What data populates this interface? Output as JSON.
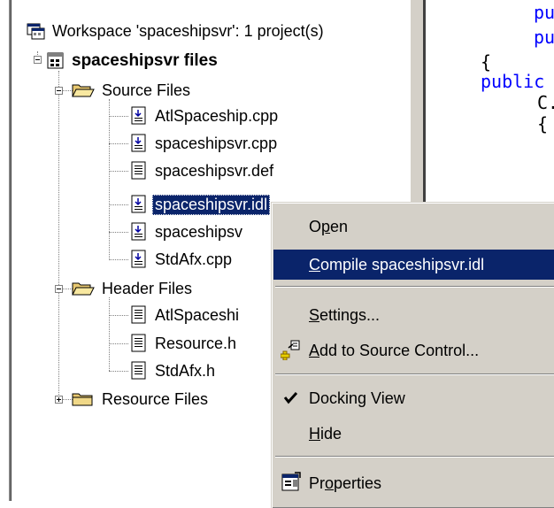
{
  "tree": {
    "workspace_label": "Workspace 'spaceshipsvr': 1 project(s)",
    "project_label": "spaceshipsvr files",
    "folders": [
      {
        "label": "Source Files",
        "expanded": true,
        "files": [
          "AtlSpaceship.cpp",
          "spaceshipsvr.cpp",
          "spaceshipsvr.def",
          "spaceshipsvr.idl",
          "spaceshipsv",
          "StdAfx.cpp"
        ]
      },
      {
        "label": "Header Files",
        "expanded": true,
        "files": [
          "AtlSpaceshi",
          "Resource.h",
          "StdAfx.h"
        ]
      },
      {
        "label": "Resource Files",
        "expanded": false,
        "files": []
      }
    ],
    "selected_file": "spaceshipsvr.idl"
  },
  "code": {
    "lines": [
      "pu",
      "pu",
      "{",
      "public",
      "C.",
      "{"
    ]
  },
  "context_menu": {
    "open": {
      "pre": "O",
      "ul": "p",
      "post": "en"
    },
    "compile": {
      "pre": "",
      "ul": "C",
      "post": "ompile spaceshipsvr.idl"
    },
    "settings": {
      "pre": "",
      "ul": "S",
      "post": "ettings..."
    },
    "add_source_control": {
      "pre": "",
      "ul": "A",
      "post": "dd to Source Control..."
    },
    "docking_view": "Docking View",
    "hide": {
      "pre": "",
      "ul": "H",
      "post": "ide"
    },
    "properties": {
      "pre": "Pr",
      "ul": "o",
      "post": "perties"
    }
  },
  "colors": {
    "selection": "#0a246a",
    "menu_bg": "#d4d0c8",
    "code_keyword": "#0000ff",
    "folder": "#e8c870"
  }
}
